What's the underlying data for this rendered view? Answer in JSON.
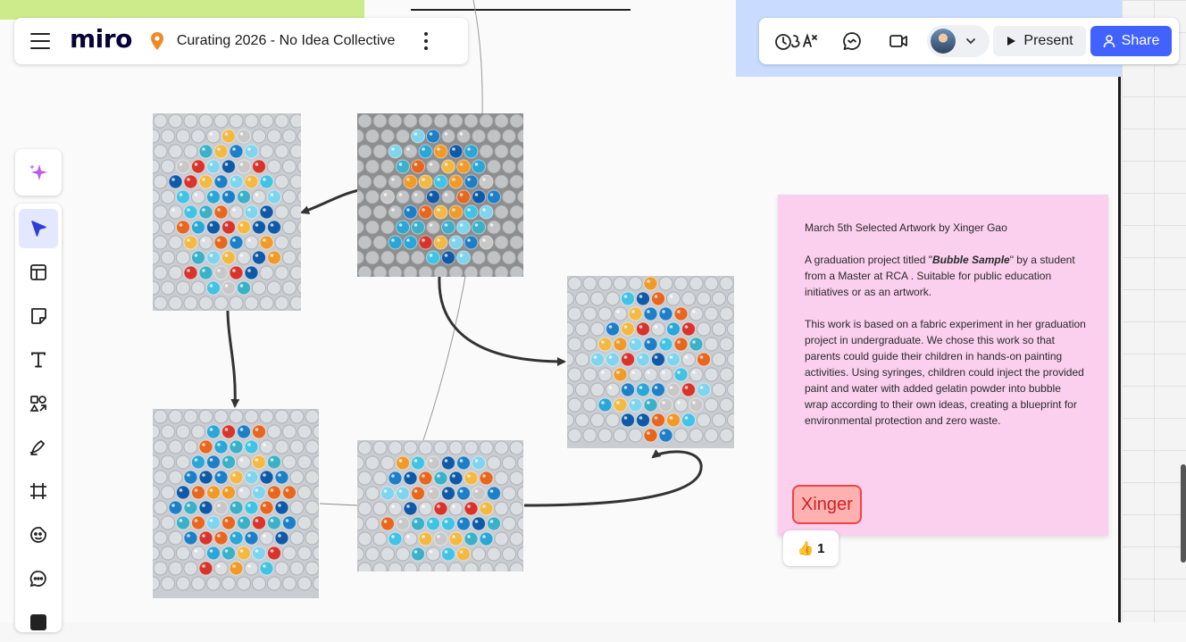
{
  "board": {
    "logo": "miro",
    "title": "Curating 2026 - No Idea Collective"
  },
  "toolbar": {
    "present_label": "Present",
    "share_label": "Share",
    "icons": [
      "reactions-icon",
      "chat-icon",
      "video-call-icon",
      "avatar",
      "play-icon",
      "share-person-icon"
    ]
  },
  "left_tools": [
    "ai-sparkle-icon",
    "select-cursor-icon",
    "templates-icon",
    "sticky-note-icon",
    "text-icon",
    "shapes-icon",
    "pen-icon",
    "frame-icon",
    "stickers-icon",
    "comment-icon"
  ],
  "sticky": {
    "heading": "March 5th Selected Artwork by Xinger Gao",
    "p2_before": "A graduation project titled \"",
    "p2_title": "Bubble Sample",
    "p2_after": "\" by a student from a Master at RCA . Suitable for public education initiatives or as an artwork.",
    "p3": "This work is based on a fabric experiment in her graduation project in undergraduate. We chose this work so that parents could guide their children in hands-on painting activities. Using syringes, children could inject the provided paint and water with added gelatin powder into bubble wrap according to their own ideas, creating a blueprint for environmental protection and zero waste.",
    "color": "#fbcfee"
  },
  "tag": {
    "label": "Xinger"
  },
  "reaction": {
    "emoji": "👍",
    "count": "1"
  },
  "colors": {
    "accent": "#4262ff",
    "brand": "#050038",
    "sticky": "#fbcfee"
  }
}
